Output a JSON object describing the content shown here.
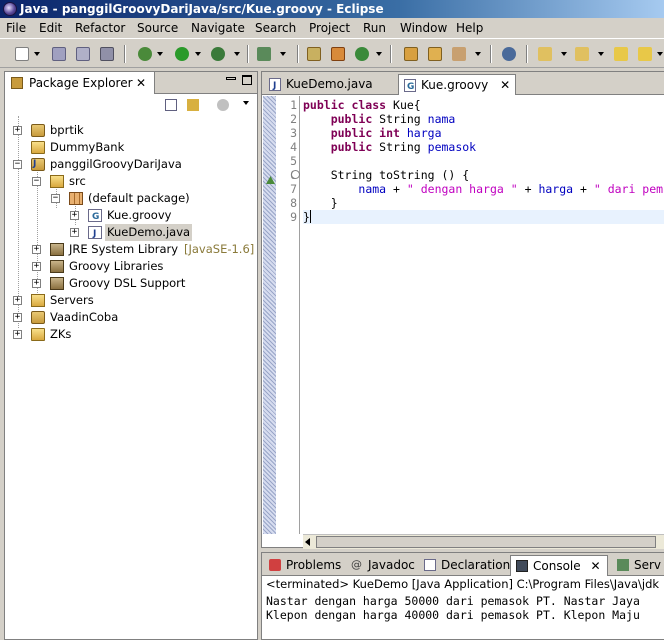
{
  "window": {
    "title": "Java - panggilGroovyDariJava/src/Kue.groovy - Eclipse"
  },
  "menu": [
    "File",
    "Edit",
    "Refactor",
    "Source",
    "Navigate",
    "Search",
    "Project",
    "Run",
    "Window",
    "Help"
  ],
  "package_explorer": {
    "tab_label": "Package Explorer",
    "close": "✕",
    "tree": [
      {
        "label": "bprtik",
        "icon": "project-icon",
        "expander": "+"
      },
      {
        "label": "DummyBank",
        "icon": "project-icon",
        "expander": ""
      },
      {
        "label": "panggilGroovyDariJava",
        "icon": "java-project-icon",
        "expander": "−"
      },
      {
        "label": "src",
        "icon": "source-folder-icon",
        "expander": "−"
      },
      {
        "label": "(default package)",
        "icon": "package-icon",
        "expander": "−"
      },
      {
        "label": "Kue.groovy",
        "icon": "groovy-file-icon",
        "expander": "+"
      },
      {
        "label": "KueDemo.java",
        "icon": "java-file-icon",
        "expander": "+"
      },
      {
        "label": "JRE System Library",
        "detail": "[JavaSE-1.6]",
        "icon": "library-icon",
        "expander": "+"
      },
      {
        "label": "Groovy Libraries",
        "icon": "library-icon",
        "expander": "+"
      },
      {
        "label": "Groovy DSL Support",
        "icon": "library-icon",
        "expander": "+"
      },
      {
        "label": "Servers",
        "icon": "folder-icon",
        "expander": "+"
      },
      {
        "label": "VaadinCoba",
        "icon": "project-icon",
        "expander": "+"
      },
      {
        "label": "ZKs",
        "icon": "folder-icon",
        "expander": "+"
      }
    ]
  },
  "editor": {
    "tabs": [
      {
        "label": "KueDemo.java",
        "active": false
      },
      {
        "label": "Kue.groovy",
        "active": true,
        "close": "✕"
      }
    ],
    "line_numbers": [
      "1",
      "2",
      "3",
      "4",
      "5",
      "6",
      "7",
      "8",
      "9"
    ],
    "code": {
      "l1_kw": "public class",
      "l1_rest": " Kue{",
      "l2_kw": "public",
      "l2_type": " String ",
      "l2_id": "nama",
      "l3_kw": "public int",
      "l3_id": " harga",
      "l4_kw": "public",
      "l4_type": " String ",
      "l4_id": "pemasok",
      "l6_text": "String toString () {",
      "l7_a": "nama",
      "l7_b": " + ",
      "l7_c": "\" dengan harga \"",
      "l7_d": " + ",
      "l7_e": "harga",
      "l7_f": " + ",
      "l7_g": "\" dari pem",
      "l8_text": "}",
      "l9_text": "}"
    }
  },
  "console": {
    "tabs": [
      "Problems",
      "Javadoc",
      "Declaration",
      "Console",
      "Serv"
    ],
    "console_close": "✕",
    "status": "<terminated> KueDemo [Java Application] C:\\Program Files\\Java\\jdk",
    "output": [
      "Nastar dengan harga 50000 dari pemasok PT. Nastar Jaya",
      "Klepon dengan harga 40000 dari pemasok PT. Klepon Maju"
    ]
  },
  "colors": {
    "keyword": "#7f0055",
    "field": "#0000c0",
    "string": "#c000c0",
    "title_bar": "#0a246a"
  }
}
